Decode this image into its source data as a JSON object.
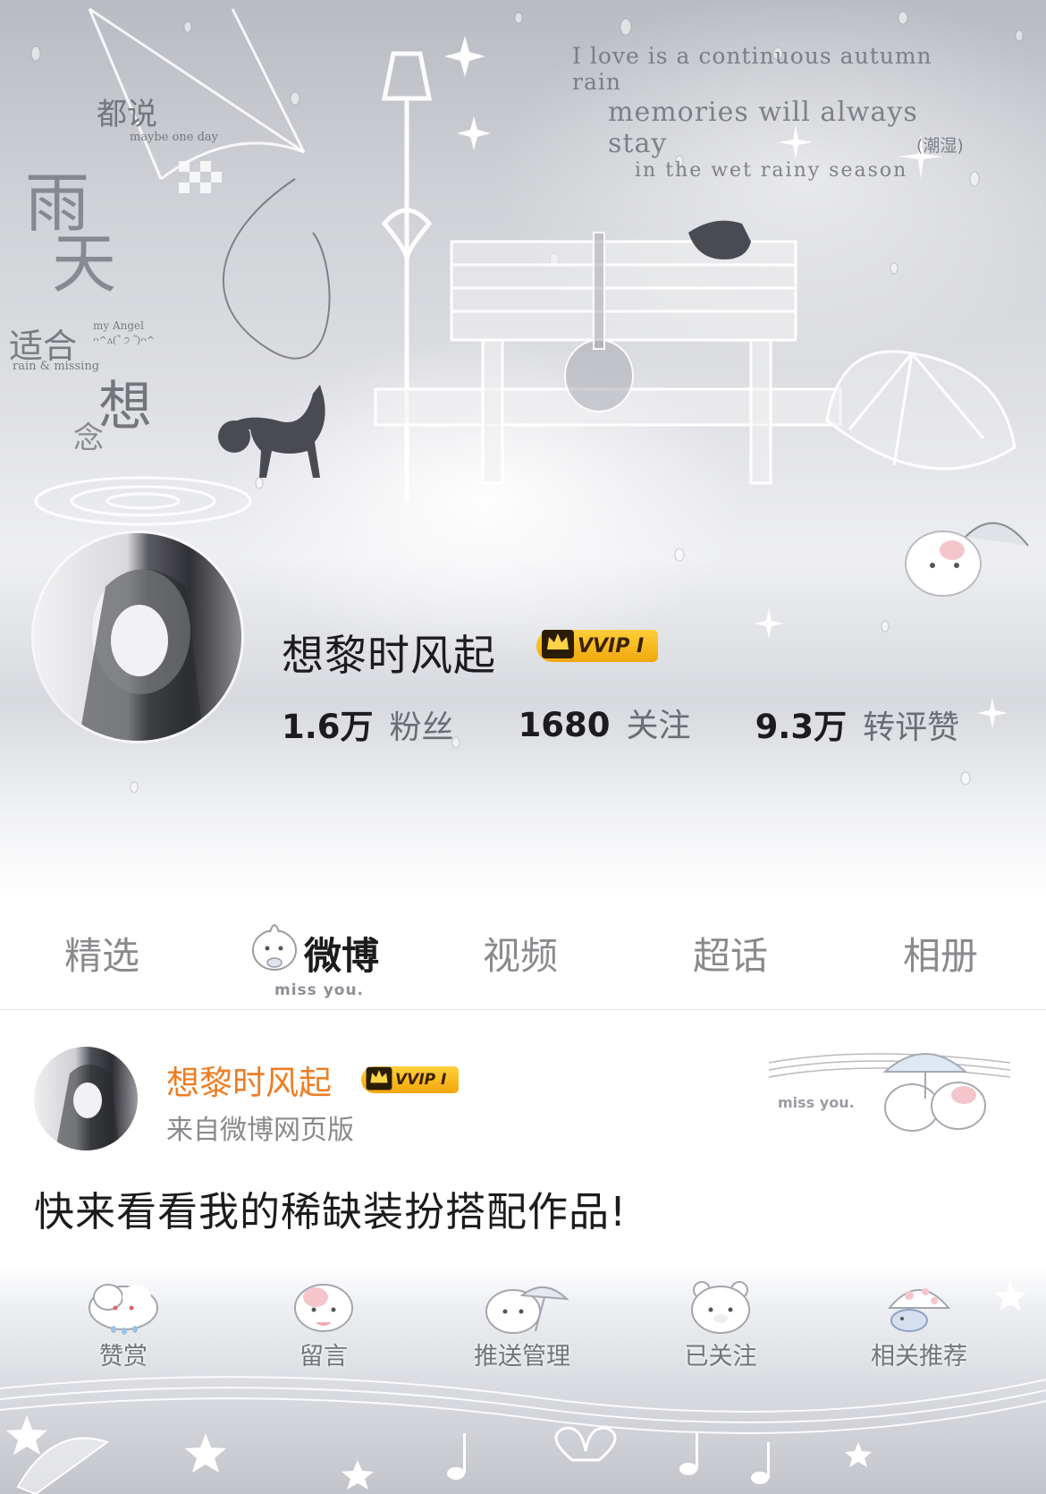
{
  "header": {
    "poem_lines": [
      "I love is a continuous autumn rain",
      "memories will always stay",
      "in the wet rainy season"
    ],
    "poem_note": "(潮湿)",
    "side_text": {
      "dushuo": "都说",
      "maybe": "maybe one day",
      "yu": "雨",
      "tian": "天",
      "shihe": "适合",
      "rain_missing": "rain & missing",
      "xiang": "想",
      "nian": "念",
      "my_angel": "my Angel",
      "kaomoji": "ᴖ^ᴧ(՞ ੭ ՞)ᴖ^"
    }
  },
  "profile": {
    "name": "想黎时风起",
    "vip_label": "VVIP Ⅰ",
    "stats": [
      {
        "value": "1.6万",
        "label": "粉丝"
      },
      {
        "value": "1680",
        "label": "关注"
      },
      {
        "value": "9.3万",
        "label": "转评赞"
      }
    ]
  },
  "tabs": {
    "items": [
      {
        "label": "精选"
      },
      {
        "label": "微博"
      },
      {
        "label": "视频"
      },
      {
        "label": "超话"
      },
      {
        "label": "相册"
      }
    ],
    "active_index": 1,
    "active_decoration": "miss you."
  },
  "post": {
    "author": "想黎时风起",
    "vip_label": "VVIP Ⅰ",
    "source": "来自微博网页版",
    "text": "快来看看我的稀缺装扮搭配作品!",
    "decoration_text": "miss you."
  },
  "actions": {
    "items": [
      {
        "label": "赞赏",
        "icon": "cloud-bunny-icon"
      },
      {
        "label": "留言",
        "icon": "bunny-icon"
      },
      {
        "label": "推送管理",
        "icon": "umbrella-bunny-icon"
      },
      {
        "label": "已关注",
        "icon": "bear-icon"
      },
      {
        "label": "相关推荐",
        "icon": "mushroom-icon"
      }
    ]
  },
  "colors": {
    "accent_orange": "#ee7d22",
    "vip_gold": "#f2a70c",
    "tab_active": "#1c1c1e",
    "tab_inactive": "#8a8a8e"
  }
}
